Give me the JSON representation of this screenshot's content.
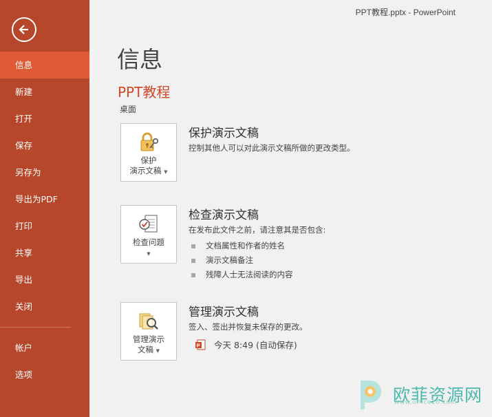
{
  "window": {
    "title": "PPT教程.pptx - PowerPoint"
  },
  "colors": {
    "sidebar": "#b7472a",
    "sidebar_active": "#e05a36",
    "accent": "#d24726",
    "background": "#f1f1f1"
  },
  "sidebar": {
    "back_icon": "back-arrow-icon",
    "items": [
      {
        "label": "信息",
        "active": true
      },
      {
        "label": "新建"
      },
      {
        "label": "打开"
      },
      {
        "label": "保存"
      },
      {
        "label": "另存为"
      },
      {
        "label": "导出为PDF"
      },
      {
        "label": "打印"
      },
      {
        "label": "共享"
      },
      {
        "label": "导出"
      },
      {
        "label": "关闭"
      }
    ],
    "bottom_items": [
      {
        "label": "帐户"
      },
      {
        "label": "选项"
      }
    ]
  },
  "main": {
    "title": "信息",
    "doc_name": "PPT教程",
    "doc_location": "桌面",
    "protect": {
      "tile_line1": "保护",
      "tile_line2": "演示文稿",
      "title": "保护演示文稿",
      "desc": "控制其他人可以对此演示文稿所做的更改类型。",
      "icon": "lock-key-icon"
    },
    "inspect": {
      "tile_label": "检查问题",
      "title": "检查演示文稿",
      "desc": "在发布此文件之前，请注意其是否包含:",
      "bullets": [
        "文档属性和作者的姓名",
        "演示文稿备注",
        "残障人士无法阅读的内容"
      ],
      "icon": "checklist-icon"
    },
    "manage": {
      "tile_line1": "管理演示",
      "tile_line2": "文稿",
      "title": "管理演示文稿",
      "desc": "签入、签出并恢复未保存的更改。",
      "version_label": "今天 8:49 (自动保存)",
      "icon": "manage-versions-icon"
    }
  },
  "watermark": {
    "text": "欧菲资源网",
    "sub": "www.office26.com"
  }
}
